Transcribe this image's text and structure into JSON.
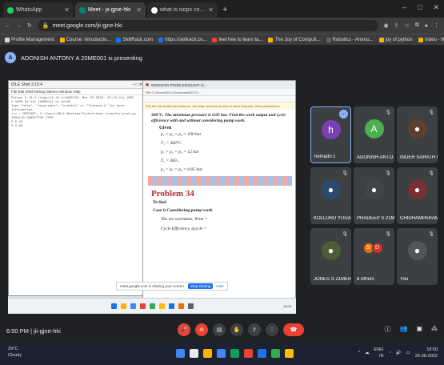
{
  "browser": {
    "tabs": [
      {
        "label": "WhatsApp",
        "color": "#25d366",
        "active": false
      },
      {
        "label": "Meet - jii-gjne-hki",
        "color": "#00897b",
        "active": true
      },
      {
        "label": "what is ciopx concept in c - Goo...",
        "color": "#ffffff",
        "active": false
      }
    ],
    "new_tab": "+",
    "window_controls": [
      "–",
      "□",
      "✕"
    ],
    "url": "meet.google.com/jii-gjne-hki",
    "bookmarks": [
      {
        "label": "Profile Management",
        "color": "#d9d9d9"
      },
      {
        "label": "Course: Introductio...",
        "color": "#f5b400"
      },
      {
        "label": "SkillRack.com",
        "color": "#1a73e8"
      },
      {
        "label": "https://skillrack.co...",
        "color": "#1a73e8"
      },
      {
        "label": "feel free to learn ta...",
        "color": "#ea4335"
      },
      {
        "label": "The Joy of Computi...",
        "color": "#f5b400"
      },
      {
        "label": "Robotics - Amrou...",
        "color": "#5f6368"
      },
      {
        "label": "joy of python",
        "color": "#f5b400"
      },
      {
        "label": "Video - Why Progra...",
        "color": "#f5b400"
      }
    ]
  },
  "presenter": {
    "avatar_letter": "A",
    "text": "ADONISH ANTONY A 20ME001 is presenting"
  },
  "shared_screen": {
    "idle_title": "IDLE Shell 3.10.4",
    "idle_menu": "File  Edit  Shell  Debug  Options  Window  Help",
    "idle_lines": [
      "Python 3.10.4 (tags/v3.10.4:9d38120, Mar 23 2022, 23:13:41) [MSC v.1929 64 bit (AMD64)] on win32",
      "Type \"help\", \"copyright\", \"credits\" or \"license()\" for more information.",
      ">>> = RESTART: C:\\Users\\DELL\\Desktop\\Python\\heat transfer\\prob.py",
      "INVALID SENSITIVE TYPE",
      "5  5.15",
      "5  1.62"
    ],
    "pdf_title": "EMISSION PROBLEMS(UNIT-2)...",
    "pdf_address": "File  C:/Users/DELL/Downloads/ECTI...",
    "pdf_warning": "The file has limited permissions. You may not have access to some features. View permissions",
    "pdf_heading": "360°C. The minimum pressure is 0.05 bar. Find the work output and cycle efficiency with and without considering pump work.",
    "given_label": "Given",
    "given_values": [
      "p₁ = p₂ = p₃ = 100 bar",
      "T₁ = 360°C",
      "p₁ = p₂ = p₃ = 12 bar",
      "T₃ = 360...",
      "p₄ = p₅ = p₆ = 0.05 bar"
    ],
    "problem_title": "Problem 34",
    "to_find": "To find",
    "case_label": "Case i) Considering pump work",
    "net_work": "The net workdone, Wnet =",
    "cycle_eff": "Cycle Efficiency, ηcycle =",
    "share_notice": "meet.google.com is sharing your screen.",
    "share_stop": "Stop sharing",
    "share_hide": "Hide",
    "inner_clock": "19:00"
  },
  "participants": [
    {
      "name": "hemadri c",
      "letter": "h",
      "color": "#7b3fb5",
      "type": "letter",
      "highlight": true
    },
    {
      "name": "ADONISH ANTO...",
      "letter": "A",
      "color": "#4caf50",
      "type": "letter",
      "highlight": false
    },
    {
      "name": "INDER SARATH M...",
      "type": "photo",
      "color": "#5c4030",
      "highlight": false
    },
    {
      "name": "KOLLURU YUGAN...",
      "type": "photo",
      "color": "#2b4a6e",
      "highlight": false
    },
    {
      "name": "PRADEEP S 21ME...",
      "type": "photo",
      "color": "#444",
      "highlight": false
    },
    {
      "name": "CHIDHAMPARAM...",
      "type": "photo",
      "color": "#7a3030",
      "highlight": false
    },
    {
      "name": "JONES S 21ME006",
      "type": "photo",
      "color": "#4d5d38",
      "highlight": false
    },
    {
      "name": "8 others",
      "type": "others",
      "others": [
        {
          "letter": "S",
          "color": "#e8710a"
        },
        {
          "letter": "D",
          "color": "#d93025"
        }
      ],
      "highlight": false
    },
    {
      "name": "You",
      "type": "photo",
      "color": "#555",
      "highlight": false
    }
  ],
  "meeting": {
    "time": "6:50 PM",
    "separator": "|",
    "code": "jii-gjne-hki"
  },
  "taskbar": {
    "weather_temp": "29°C",
    "weather_desc": "Cloudy",
    "lang": "ENG",
    "region": "IN",
    "clock_time": "18:50",
    "clock_date": "26-08-2022",
    "app_colors": [
      "#4285f4",
      "#e8eaed",
      "#ffb300",
      "#4285f4",
      "#0f9d58",
      "#ea4335",
      "#1a73e8",
      "#34a853",
      "#fbbc05"
    ]
  }
}
